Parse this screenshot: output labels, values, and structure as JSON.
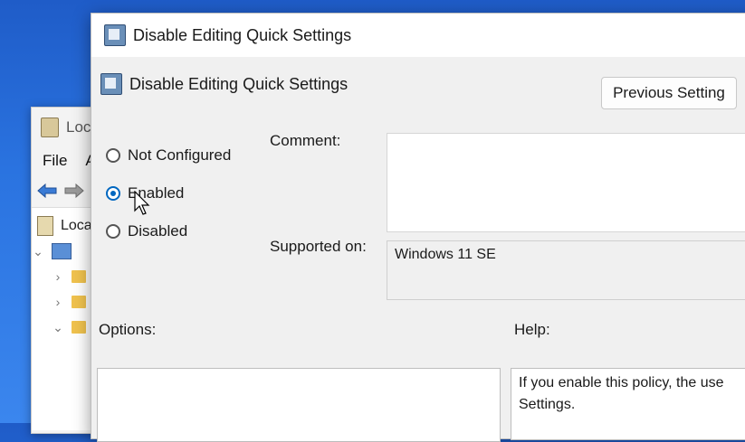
{
  "background_window": {
    "title": "Loca",
    "menu": [
      "File",
      "A"
    ],
    "tree_root": "Loca"
  },
  "dialog": {
    "window_title": "Disable Editing Quick Settings",
    "policy_title": "Disable Editing Quick Settings",
    "previous_button": "Previous Setting",
    "radio_options": [
      {
        "label": "Not Configured",
        "checked": false
      },
      {
        "label": "Enabled",
        "checked": true
      },
      {
        "label": "Disabled",
        "checked": false
      }
    ],
    "comment_label": "Comment:",
    "comment_value": "",
    "supported_label": "Supported on:",
    "supported_value": "Windows 11 SE",
    "options_label": "Options:",
    "help_label": "Help:",
    "help_text": [
      "If you enable this policy, the use",
      "Settings."
    ]
  },
  "colors": {
    "accent": "#0067c0",
    "desktop": "#2a73e0"
  }
}
